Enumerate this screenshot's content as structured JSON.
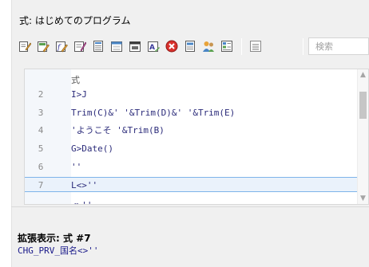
{
  "window": {
    "title": "式: はじめてのプログラム"
  },
  "toolbar": {
    "buttons": [
      {
        "icon": "edit-icon"
      },
      {
        "icon": "fields-icon"
      },
      {
        "icon": "function-icon"
      },
      {
        "icon": "properties-icon"
      },
      {
        "icon": "table-icon"
      },
      {
        "icon": "form-icon"
      },
      {
        "icon": "report-icon"
      },
      {
        "icon": "variable-icon"
      },
      {
        "icon": "error-icon"
      },
      {
        "icon": "document-icon"
      },
      {
        "icon": "users-icon"
      },
      {
        "icon": "list-icon"
      },
      {
        "icon": "expand-icon"
      }
    ],
    "search_placeholder": "検索"
  },
  "editor": {
    "header": "式",
    "lines": [
      {
        "num": "2",
        "code": "I>J"
      },
      {
        "num": "3",
        "code": "Trim(C)&' '&Trim(D)&' '&Trim(E)"
      },
      {
        "num": "4",
        "code": "'ようこそ '&Trim(B)"
      },
      {
        "num": "5",
        "code": "G>Date()"
      },
      {
        "num": "6",
        "code": "''"
      },
      {
        "num": "7",
        "code": "L<>''"
      },
      {
        "num": "",
        "code": "<>''"
      }
    ],
    "selected_line": 6
  },
  "expanded": {
    "label": "拡張表示: 式 #7",
    "value": "CHG_PRV_国名<>''"
  }
}
